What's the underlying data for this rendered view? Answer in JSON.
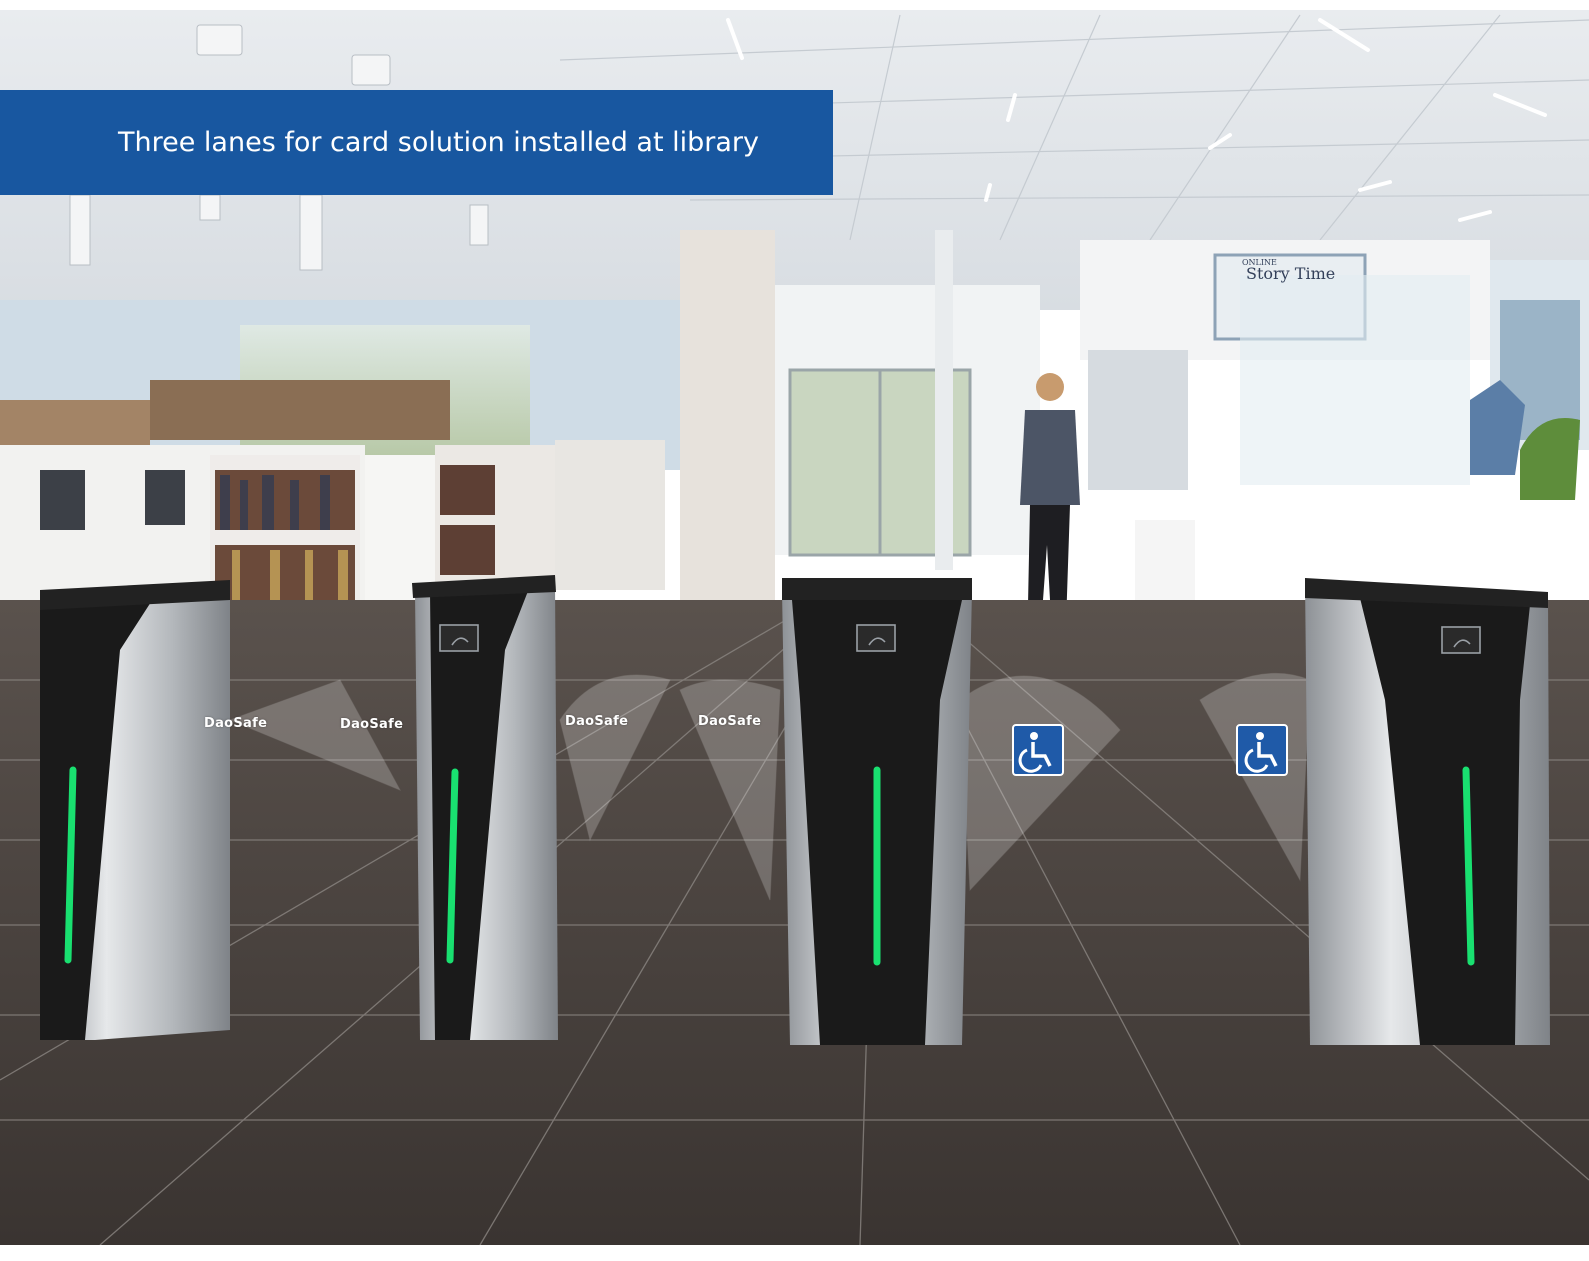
{
  "caption": {
    "text": "Three lanes for card solution installed at library"
  },
  "gate_brand_labels": [
    "DaoSafe",
    "DaoSafe",
    "DaoSafe",
    "DaoSafe"
  ],
  "wall_sign": {
    "line1": "ONLINE",
    "title": "Story Time"
  },
  "icons": {
    "accessible": "wheelchair-icon",
    "reader": "card-reader-icon"
  },
  "colors": {
    "caption_bg": "#1857a0",
    "caption_text": "#ffffff",
    "indicator_green": "#19e070",
    "accessible_sign_bg": "#1f5aa8",
    "gate_body": "#1a1a1a",
    "gate_steel": "#b9bdc2"
  }
}
